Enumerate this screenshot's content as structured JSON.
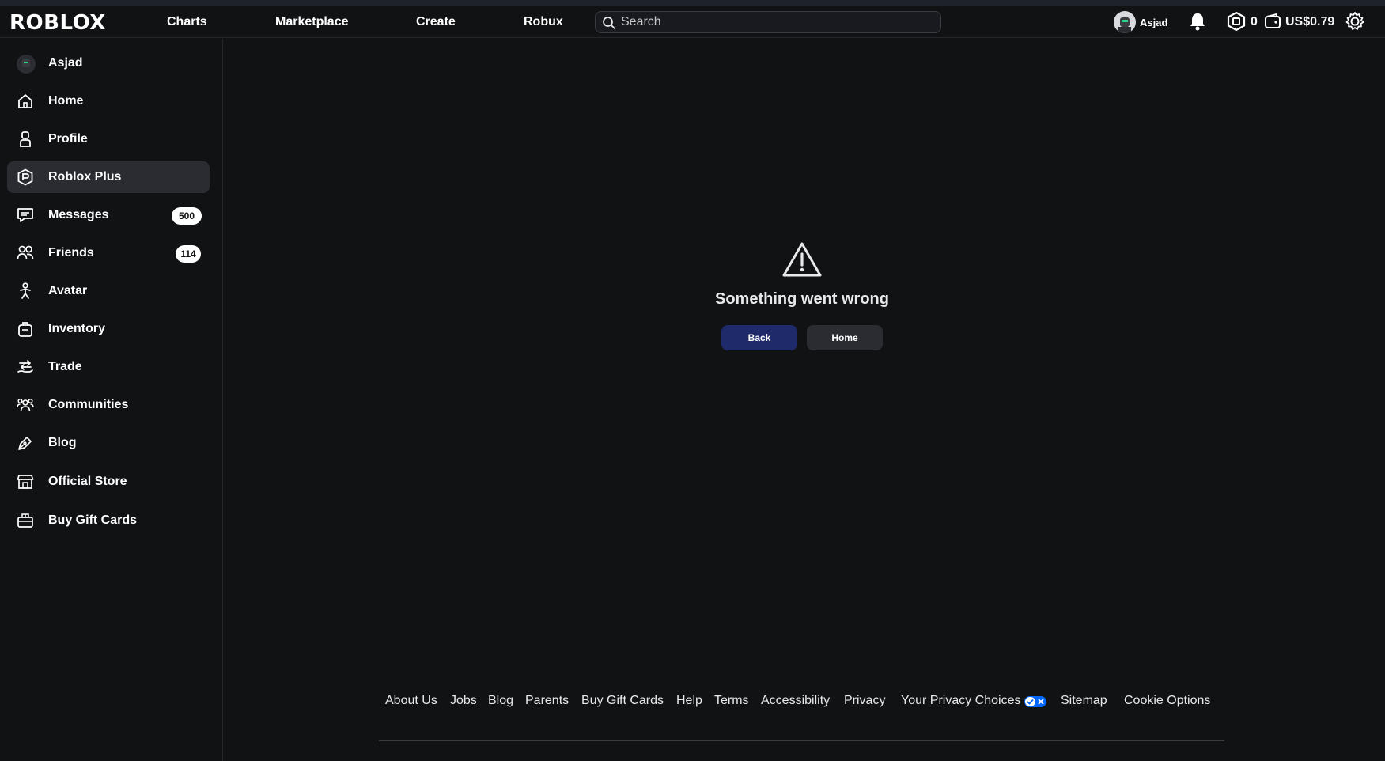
{
  "header": {
    "logo": "ROBLOX",
    "nav": [
      "Charts",
      "Marketplace",
      "Create",
      "Robux"
    ],
    "search_placeholder": "Search",
    "username": "Asjad",
    "robux": "0",
    "balance": "US$0.79",
    "icons": [
      "search-icon",
      "bell-icon",
      "robux-icon",
      "wallet-icon",
      "gear-icon"
    ]
  },
  "sidebar": {
    "user": "Asjad",
    "items": [
      {
        "label": "Home",
        "icon": "home-icon"
      },
      {
        "label": "Profile",
        "icon": "profile-icon"
      },
      {
        "label": "Roblox Plus",
        "icon": "roblox-plus-icon",
        "active": true
      },
      {
        "label": "Messages",
        "icon": "message-icon",
        "badge": "500"
      },
      {
        "label": "Friends",
        "icon": "friends-icon",
        "badge": "114"
      },
      {
        "label": "Avatar",
        "icon": "avatar-icon"
      },
      {
        "label": "Inventory",
        "icon": "backpack-icon"
      },
      {
        "label": "Trade",
        "icon": "trade-icon"
      },
      {
        "label": "Communities",
        "icon": "communities-icon"
      },
      {
        "label": "Blog",
        "icon": "pen-icon"
      },
      {
        "label": "Official Store",
        "icon": "store-icon"
      },
      {
        "label": "Buy Gift Cards",
        "icon": "gift-card-icon"
      }
    ]
  },
  "main": {
    "error_title": "Something went wrong",
    "back_label": "Back",
    "home_label": "Home"
  },
  "footer": {
    "links": [
      "About Us",
      "Jobs",
      "Blog",
      "Parents",
      "Buy Gift Cards",
      "Help",
      "Terms",
      "Accessibility",
      "Privacy",
      "Your Privacy Choices",
      "Sitemap",
      "Cookie Options"
    ]
  },
  "colors": {
    "background": "#111214",
    "active_item": "#2a2c32",
    "back_button": "#1f2a6b",
    "privacy_toggle": "#0066ff"
  }
}
